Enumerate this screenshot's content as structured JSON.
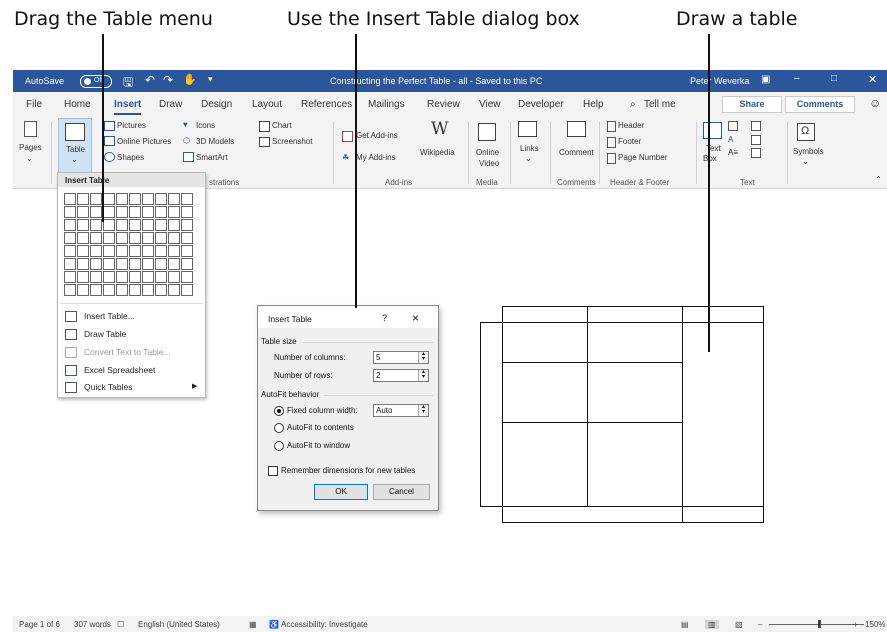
{
  "callouts": {
    "drag_table_menu": "Drag the Table menu",
    "insert_table_dialog": "Use the Insert Table dialog box",
    "draw_table": "Draw a table"
  },
  "titlebar": {
    "autosave_label": "AutoSave",
    "autosave_state": "Off",
    "document_title": "Constructing the Perfect Table - all - Saved to this PC",
    "user_name": "Peter Weverka",
    "accent_color": "#2b579a"
  },
  "tabs": [
    "File",
    "Home",
    "Insert",
    "Draw",
    "Design",
    "Layout",
    "References",
    "Mailings",
    "Review",
    "View",
    "Developer",
    "Help"
  ],
  "active_tab": "Insert",
  "tell_me": "Tell me",
  "share_label": "Share",
  "comments_label": "Comments",
  "ribbon": {
    "pages": "Pages",
    "table": "Table",
    "pictures": "Pictures",
    "online_pictures": "Online Pictures",
    "shapes": "Shapes",
    "icons": "Icons",
    "models_3d": "3D Models",
    "smartart": "SmartArt",
    "chart": "Chart",
    "screenshot": "Screenshot",
    "illustrations_partial": "strations",
    "get_addins": "Get Add-ins",
    "my_addins": "My Add-ins",
    "wikipedia": "Wikipedia",
    "addins_group": "Add-ins",
    "online_video_1": "Online",
    "online_video_2": "Video",
    "media_group": "Media",
    "links": "Links",
    "comment": "Comment",
    "comments_group": "Comments",
    "header": "Header",
    "footer": "Footer",
    "page_number": "Page Number",
    "header_footer_group": "Header & Footer",
    "text_box_1": "Text",
    "text_box_2": "Box",
    "text_group": "Text",
    "symbols": "Symbols"
  },
  "insert_table_menu": {
    "header": "Insert Table",
    "grid_columns": 10,
    "grid_rows": 8,
    "items": [
      {
        "label": "Insert Table...",
        "enabled": true,
        "icon": "table-icon"
      },
      {
        "label": "Draw Table",
        "enabled": true,
        "icon": "pencil-table-icon"
      },
      {
        "label": "Convert Text to Table...",
        "enabled": false,
        "icon": "convert-icon"
      },
      {
        "label": "Excel Spreadsheet",
        "enabled": true,
        "icon": "excel-icon"
      },
      {
        "label": "Quick Tables",
        "enabled": true,
        "icon": "quick-tables-icon"
      }
    ]
  },
  "insert_table_dialog": {
    "title": "Insert Table",
    "help": "?",
    "close": "×",
    "table_size_label": "Table size",
    "columns_label": "Number of columns:",
    "columns_value": "5",
    "rows_label": "Number of rows:",
    "rows_value": "2",
    "autofit_label": "AutoFit behavior",
    "fixed_width_label": "Fixed column width:",
    "fixed_width_value": "Auto",
    "autofit_contents_label": "AutoFit to contents",
    "autofit_window_label": "AutoFit to window",
    "selected_option": "fixed",
    "remember_label": "Remember dimensions for new tables",
    "remember_checked": false,
    "ok_label": "OK",
    "cancel_label": "Cancel"
  },
  "statusbar": {
    "page": "Page 1 of 6",
    "words": "307 words",
    "language": "English (United States)",
    "accessibility": "Accessibility: Investigate",
    "zoom": "150%"
  }
}
